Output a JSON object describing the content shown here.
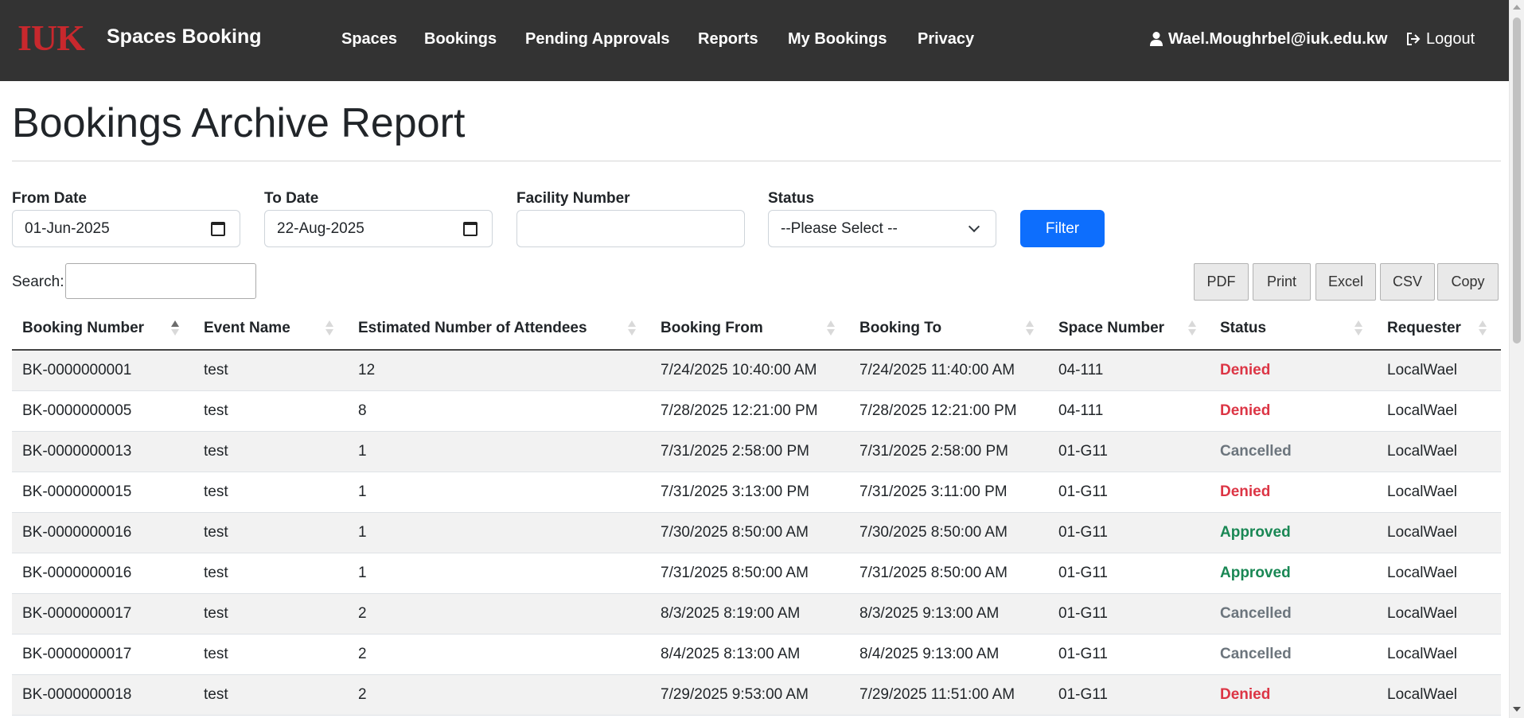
{
  "app": {
    "logo_text": "IUK",
    "name": "Spaces Booking"
  },
  "nav": {
    "items": [
      {
        "label": "Spaces"
      },
      {
        "label": "Bookings"
      },
      {
        "label": "Pending Approvals"
      },
      {
        "label": "Reports"
      },
      {
        "label": "My Bookings"
      },
      {
        "label": "Privacy"
      }
    ],
    "user_icon": "user-icon",
    "user_email": "Wael.Moughrbel@iuk.edu.kw",
    "logout_icon": "logout-icon",
    "logout_label": "Logout"
  },
  "page": {
    "title": "Bookings Archive Report"
  },
  "filters": {
    "from_date_label": "From Date",
    "from_date_value": "01-Jun-2025",
    "to_date_label": "To Date",
    "to_date_value": "22-Aug-2025",
    "facility_label": "Facility Number",
    "facility_value": "",
    "status_label": "Status",
    "status_value": "--Please Select --",
    "filter_button": "Filter",
    "calendar_icon": "calendar-icon",
    "dropdown_icon": "chevron-down-icon"
  },
  "search": {
    "label": "Search:",
    "value": ""
  },
  "export_buttons": [
    "PDF",
    "Print",
    "Excel",
    "CSV",
    "Copy"
  ],
  "table": {
    "columns": [
      "Booking Number",
      "Event Name",
      "Estimated Number of Attendees",
      "Booking From",
      "Booking To",
      "Space Number",
      "Status",
      "Requester"
    ],
    "sorted_column": "Booking Number",
    "sort_direction": "ascending",
    "rows": [
      [
        "BK-0000000001",
        "test",
        "12",
        "7/24/2025 10:40:00 AM",
        "7/24/2025 11:40:00 AM",
        "04-111",
        "Denied",
        "LocalWael"
      ],
      [
        "BK-0000000005",
        "test",
        "8",
        "7/28/2025 12:21:00 PM",
        "7/28/2025 12:21:00 PM",
        "04-111",
        "Denied",
        "LocalWael"
      ],
      [
        "BK-0000000013",
        "test",
        "1",
        "7/31/2025 2:58:00 PM",
        "7/31/2025 2:58:00 PM",
        "01-G11",
        "Cancelled",
        "LocalWael"
      ],
      [
        "BK-0000000015",
        "test",
        "1",
        "7/31/2025 3:13:00 PM",
        "7/31/2025 3:11:00 PM",
        "01-G11",
        "Denied",
        "LocalWael"
      ],
      [
        "BK-0000000016",
        "test",
        "1",
        "7/30/2025 8:50:00 AM",
        "7/30/2025 8:50:00 AM",
        "01-G11",
        "Approved",
        "LocalWael"
      ],
      [
        "BK-0000000016",
        "test",
        "1",
        "7/31/2025 8:50:00 AM",
        "7/31/2025 8:50:00 AM",
        "01-G11",
        "Approved",
        "LocalWael"
      ],
      [
        "BK-0000000017",
        "test",
        "2",
        "8/3/2025 8:19:00 AM",
        "8/3/2025 9:13:00 AM",
        "01-G11",
        "Cancelled",
        "LocalWael"
      ],
      [
        "BK-0000000017",
        "test",
        "2",
        "8/4/2025 8:13:00 AM",
        "8/4/2025 9:13:00 AM",
        "01-G11",
        "Cancelled",
        "LocalWael"
      ],
      [
        "BK-0000000018",
        "test",
        "2",
        "7/29/2025 9:53:00 AM",
        "7/29/2025 11:51:00 AM",
        "01-G11",
        "Denied",
        "LocalWael"
      ]
    ]
  },
  "colors": {
    "navbar": "#333333",
    "brand_red": "#c8282d",
    "primary": "#0d6efd",
    "denied": "#dc3545",
    "cancelled": "#6c757d",
    "approved": "#198754"
  }
}
